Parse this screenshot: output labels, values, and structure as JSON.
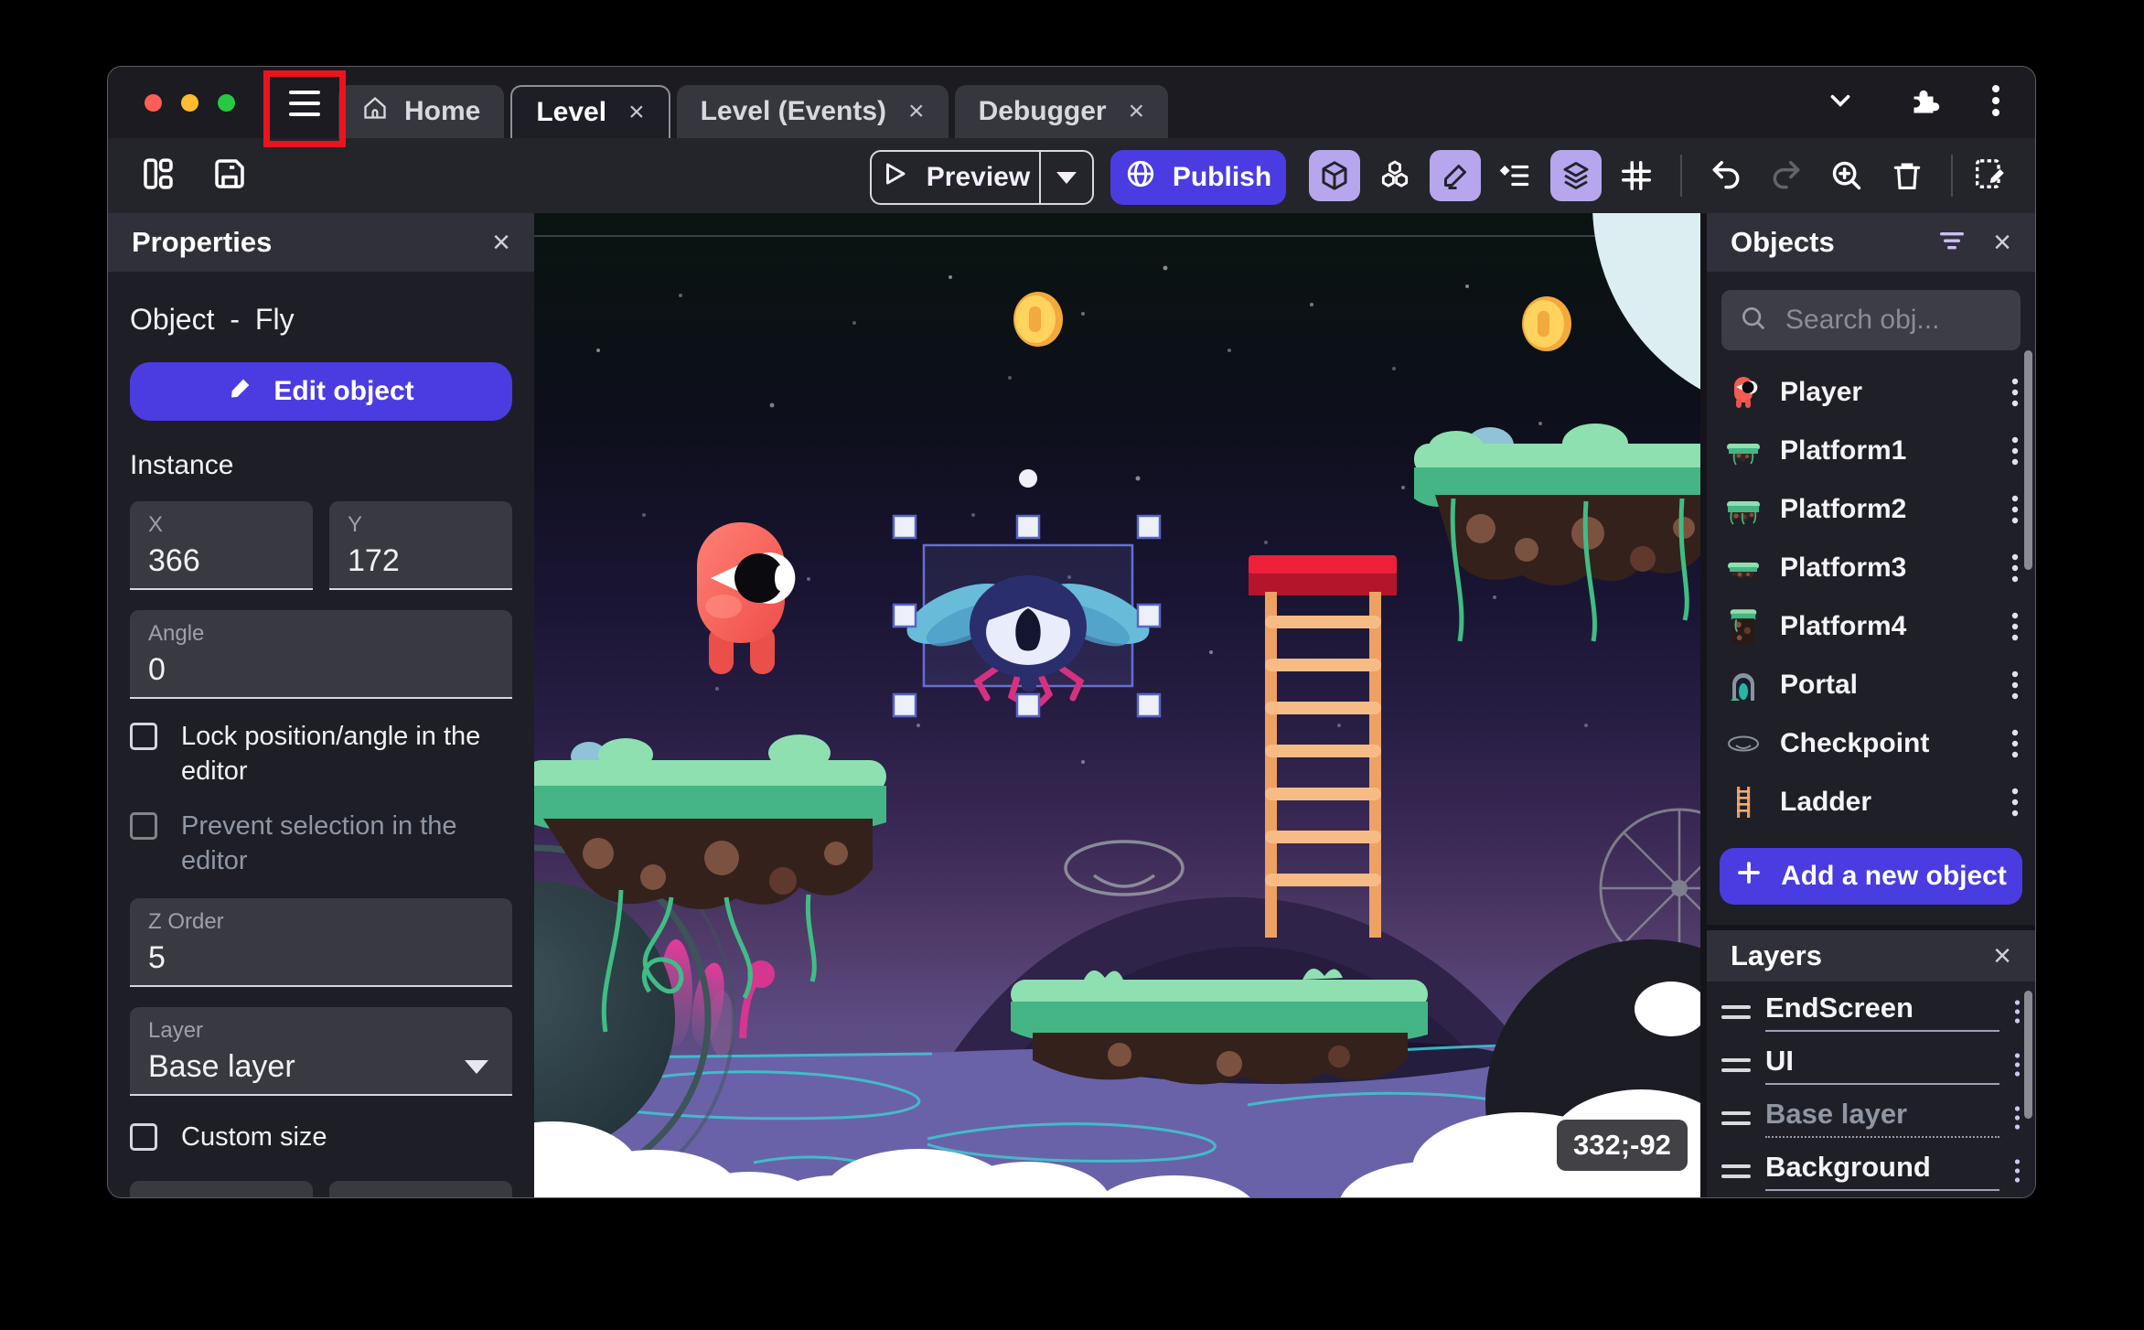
{
  "titlebar": {
    "close_symbol": "×",
    "tabs": [
      {
        "label": "Home",
        "active": false,
        "closable": false
      },
      {
        "label": "Level",
        "active": true,
        "closable": true
      },
      {
        "label": "Level (Events)",
        "active": false,
        "closable": true
      },
      {
        "label": "Debugger",
        "active": false,
        "closable": true
      }
    ]
  },
  "toolbar": {
    "preview_label": "Preview",
    "publish_label": "Publish"
  },
  "properties_panel": {
    "title": "Properties",
    "object_label": "Object - Fly",
    "edit_object_label": "Edit object",
    "instance_heading": "Instance",
    "x_field": {
      "label": "X",
      "value": "366"
    },
    "y_field": {
      "label": "Y",
      "value": "172"
    },
    "angle_field": {
      "label": "Angle",
      "value": "0"
    },
    "lock_checkbox": "Lock position/angle in the editor",
    "prevent_checkbox": "Prevent selection in the editor",
    "zorder_field": {
      "label": "Z Order",
      "value": "5"
    },
    "layer_field": {
      "label": "Layer",
      "value": "Base layer"
    },
    "custom_size_checkbox": "Custom size"
  },
  "objects_panel": {
    "title": "Objects",
    "search_placeholder": "Search obj...",
    "items": [
      {
        "name": "Player",
        "thumb": "player"
      },
      {
        "name": "Platform1",
        "thumb": "platform1"
      },
      {
        "name": "Platform2",
        "thumb": "platform2"
      },
      {
        "name": "Platform3",
        "thumb": "platform3"
      },
      {
        "name": "Platform4",
        "thumb": "platform4"
      },
      {
        "name": "Portal",
        "thumb": "portal"
      },
      {
        "name": "Checkpoint",
        "thumb": "checkpoint"
      },
      {
        "name": "Ladder",
        "thumb": "ladder"
      }
    ],
    "add_button_label": "Add a new object"
  },
  "layers_panel": {
    "title": "Layers",
    "layers": [
      {
        "name": "EndScreen",
        "muted": false
      },
      {
        "name": "UI",
        "muted": false
      },
      {
        "name": "Base layer",
        "muted": true
      },
      {
        "name": "Background",
        "muted": false
      }
    ]
  },
  "canvas": {
    "selected_object": "Fly",
    "coordinates_tooltip": "332;-92"
  },
  "colors": {
    "accent": "#4a3ce0",
    "active_tool_bg": "#b7a6ee",
    "selection": "#5864c8",
    "annotation_red": "#ea1420",
    "grass": "#45b585",
    "dirt": "#34211c",
    "ground": "#6a62a8"
  }
}
